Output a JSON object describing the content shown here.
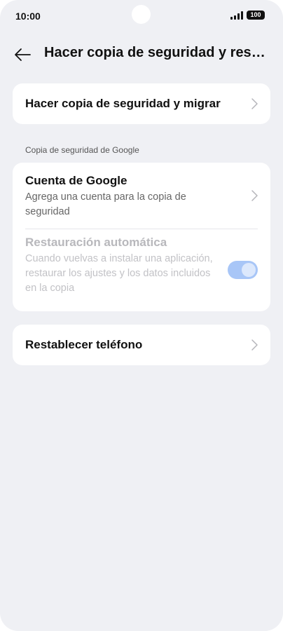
{
  "status_bar": {
    "time": "10:00",
    "battery": "100"
  },
  "header": {
    "title": "Hacer copia de seguridad y restab…"
  },
  "backup_card": {
    "label": "Hacer copia de seguridad y migrar"
  },
  "google_section": {
    "label": "Copia de seguridad de Google",
    "account": {
      "title": "Cuenta de Google",
      "subtitle": "Agrega una cuenta para la copia de seguridad"
    },
    "auto_restore": {
      "title": "Restauración automática",
      "subtitle": "Cuando vuelvas a instalar una aplicación, restaurar los ajustes y los datos incluidos en la copia",
      "enabled": true
    }
  },
  "reset_card": {
    "label": "Restablecer teléfono"
  },
  "colors": {
    "background": "#eff0f4",
    "card": "#ffffff",
    "toggle_track": "#a8c6f7",
    "disabled_text": "#b8b8bc"
  },
  "icons": [
    "back-arrow-icon",
    "chevron-right-icon",
    "signal-icon",
    "battery-icon"
  ]
}
